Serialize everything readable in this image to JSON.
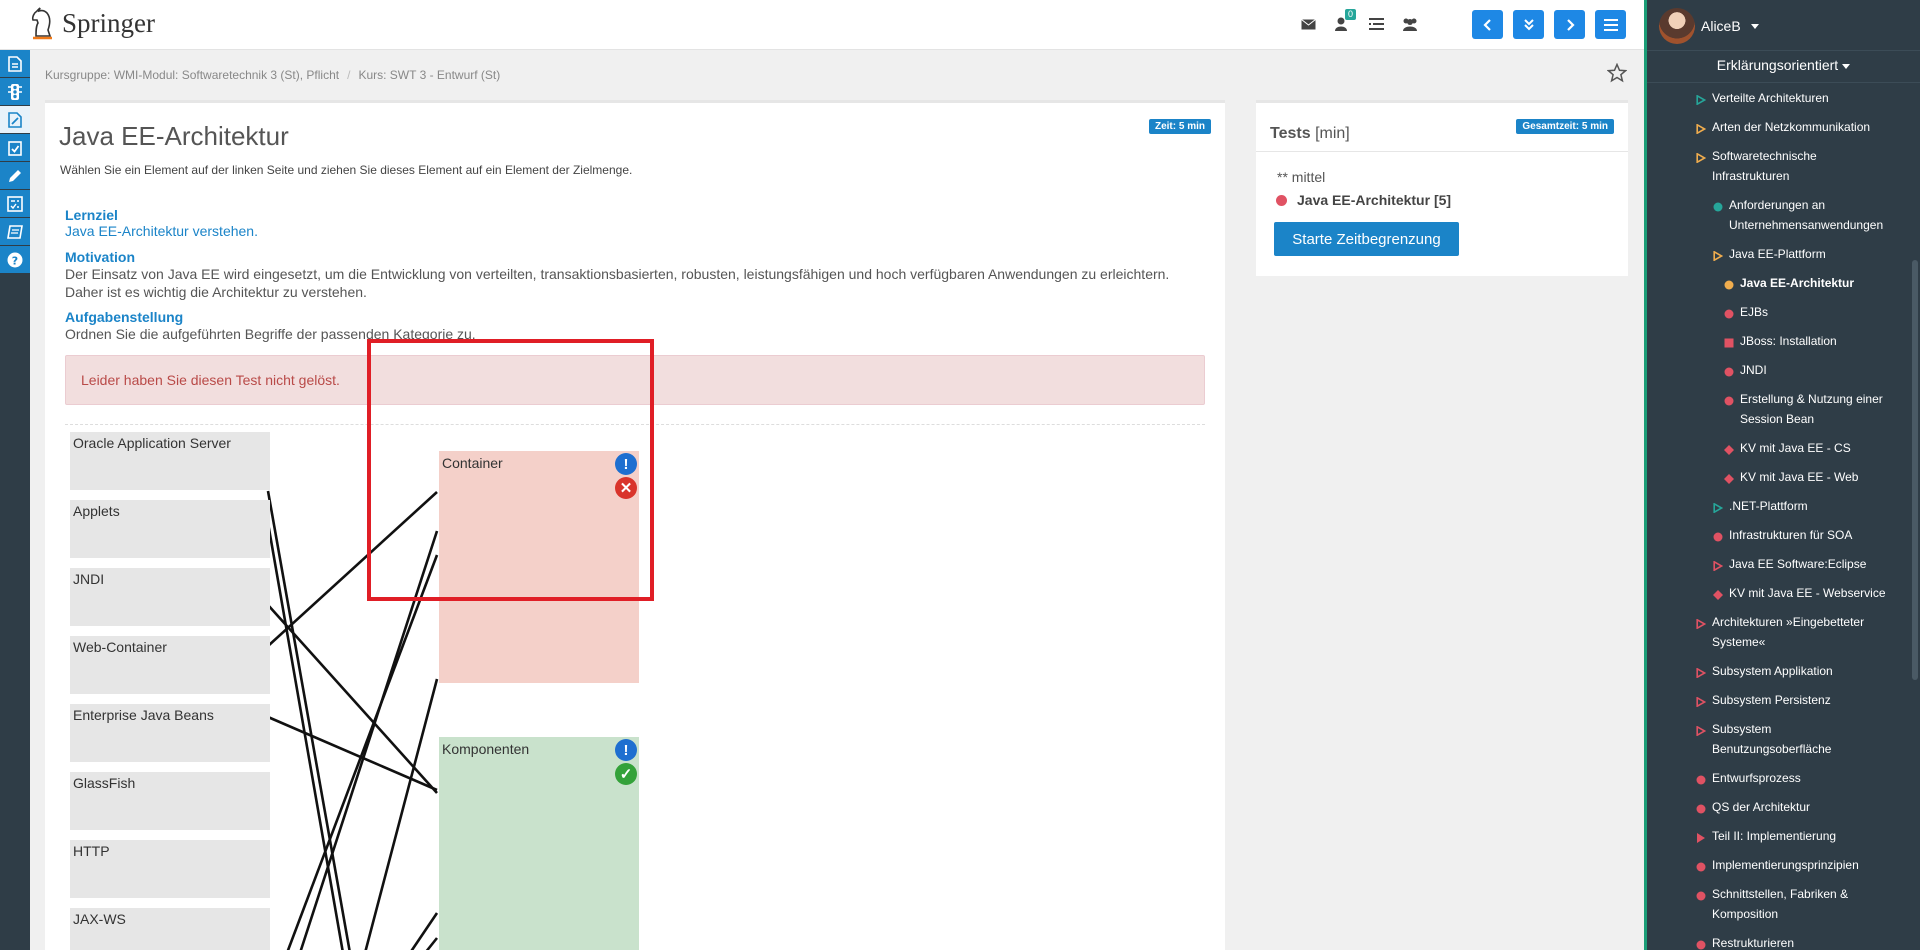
{
  "brand": "Springer",
  "header": {
    "icons": [
      "mail-icon",
      "notification-icon",
      "list-icon",
      "users-icon"
    ],
    "notification_count": "0",
    "nav_buttons": [
      "prev-icon",
      "jump-down-icon",
      "next-icon",
      "menu-icon"
    ]
  },
  "breadcrumb": {
    "items": [
      "Kursgruppe: WMI-Modul: Softwaretechnik 3 (St), Pflicht",
      "Kurs: SWT 3 - Entwurf (St)"
    ],
    "separator": "/"
  },
  "task": {
    "title": "Java EE-Architektur",
    "time_badge": "Zeit: 5 min",
    "instruction": "Wählen Sie ein Element auf der linken Seite und ziehen Sie dieses Element auf ein Element der Zielmenge.",
    "lernziel_head": "Lernziel",
    "lernziel_text": "Java EE-Architektur verstehen.",
    "motivation_head": "Motivation",
    "motivation_text": "Der Einsatz von Java EE wird eingesetzt, um die Entwicklung von verteilten, transaktionsbasierten, robusten, leistungsfähigen und hoch verfügbaren Anwendungen zu erleichtern. Daher ist es wichtig die Architektur zu verstehen.",
    "aufgabe_head": "Aufgabenstellung",
    "aufgabe_text": "Ordnen Sie die aufgeführten Begriffe der passenden Kategorie zu.",
    "alert": "Leider haben Sie diesen Test nicht gelöst."
  },
  "sources": [
    "Oracle Application Server",
    "Applets",
    "JNDI",
    "Web-Container",
    "Enterprise Java Beans",
    "GlassFish",
    "HTTP",
    "JAX-WS"
  ],
  "targets": [
    {
      "label": "Container",
      "status": "wrong"
    },
    {
      "label": "Komponenten",
      "status": "correct"
    }
  ],
  "tests_panel": {
    "title": "Tests",
    "unit": "[min]",
    "badge": "Gesamtzeit: 5 min",
    "level": "** mittel",
    "test_name": "Java EE-Architektur [5]",
    "start_button": "Starte Zeitbegrenzung"
  },
  "sidebar": {
    "user": "AliceB",
    "mode": "Erklärungsorientiert",
    "items": [
      {
        "label": "Verteilte Architekturen",
        "marker": "triangle-outline",
        "color": "#26a69a"
      },
      {
        "label": "Arten der Netzkommunikation",
        "marker": "triangle-outline",
        "color": "#f0ad4e"
      },
      {
        "label": "Softwaretechnische Infrastrukturen",
        "marker": "triangle-outline",
        "color": "#f0ad4e"
      },
      {
        "label": "Anforderungen an Unternehmensanwendungen",
        "marker": "circle",
        "color": "#26a69a"
      },
      {
        "label": "Java EE-Plattform",
        "marker": "triangle-outline",
        "color": "#f0ad4e"
      },
      {
        "label": "Java EE-Architektur",
        "marker": "circle",
        "color": "#f0ad4e"
      },
      {
        "label": "EJBs",
        "marker": "circle",
        "color": "#e05263"
      },
      {
        "label": "JBoss: Installation",
        "marker": "square",
        "color": "#e05263"
      },
      {
        "label": "JNDI",
        "marker": "circle",
        "color": "#e05263"
      },
      {
        "label": "Erstellung & Nutzung einer Session Bean",
        "marker": "circle",
        "color": "#e05263"
      },
      {
        "label": "KV mit Java EE - CS",
        "marker": "diamond",
        "color": "#e05263"
      },
      {
        "label": "KV mit Java EE - Web",
        "marker": "diamond",
        "color": "#e05263"
      },
      {
        "label": ".NET-Plattform",
        "marker": "triangle-outline",
        "color": "#26a69a"
      },
      {
        "label": "Infrastrukturen für SOA",
        "marker": "circle",
        "color": "#e05263"
      },
      {
        "label": "Java EE Software:Eclipse",
        "marker": "triangle-outline",
        "color": "#e05263"
      },
      {
        "label": "KV mit Java EE - Webservice",
        "marker": "diamond",
        "color": "#e05263"
      },
      {
        "label": "Architekturen »Eingebetteter Systeme«",
        "marker": "triangle-outline",
        "color": "#e05263"
      },
      {
        "label": "Subsystem Applikation",
        "marker": "triangle-outline",
        "color": "#e05263"
      },
      {
        "label": "Subsystem Persistenz",
        "marker": "triangle-outline",
        "color": "#e05263"
      },
      {
        "label": "Subsystem Benutzungsoberfläche",
        "marker": "triangle-outline",
        "color": "#e05263"
      },
      {
        "label": "Entwurfsprozess",
        "marker": "circle",
        "color": "#e05263"
      },
      {
        "label": "QS der Architektur",
        "marker": "circle",
        "color": "#e05263"
      },
      {
        "label": "Teil II: Implementierung",
        "marker": "triangle",
        "color": "#e05263"
      },
      {
        "label": "Implementierungsprinzipien",
        "marker": "circle",
        "color": "#e05263"
      },
      {
        "label": "Schnittstellen, Fabriken & Komposition",
        "marker": "circle",
        "color": "#e05263"
      },
      {
        "label": "Restrukturieren",
        "marker": "circle",
        "color": "#e05263"
      }
    ]
  }
}
